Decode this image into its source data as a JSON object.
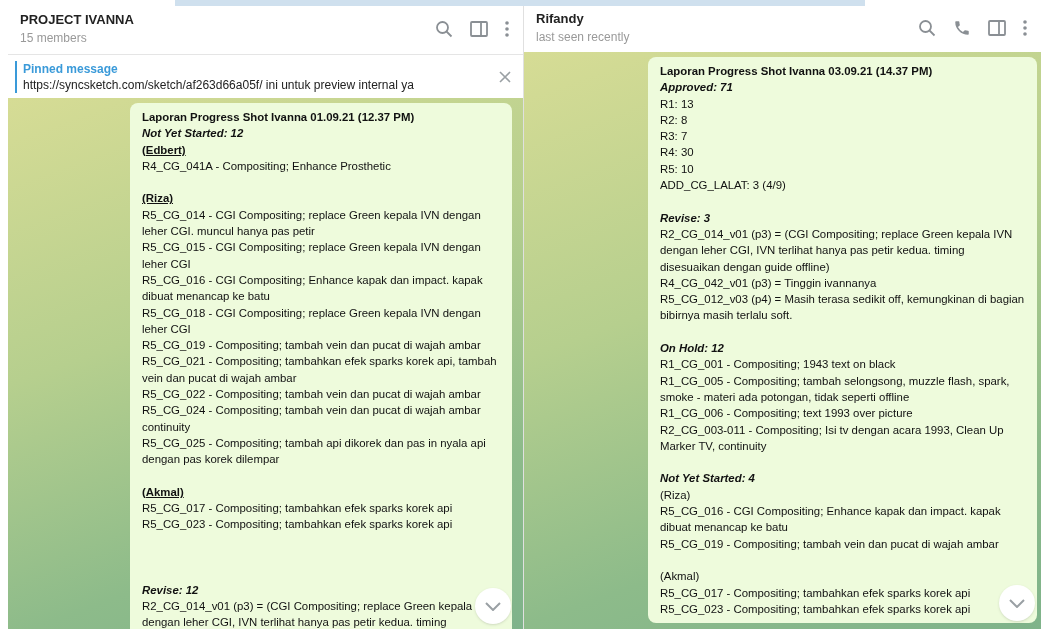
{
  "chats": [
    {
      "kind": "group",
      "title": "PROJECT IVANNA",
      "subtitle": "15 members",
      "pinned": {
        "label": "Pinned message",
        "text": "https://syncsketch.com/sketch/af263d66a05f/  ini untuk preview internal ya"
      },
      "message": [
        {
          "kind": "heading",
          "text": "Laporan Progress Shot Ivanna 01.09.21 (12.37 PM)"
        },
        {
          "kind": "status",
          "text": "Not Yet Started: 12"
        },
        {
          "kind": "person",
          "text": "(Edbert)"
        },
        {
          "kind": "item",
          "text": "R4_CG_041A - Compositing; Enhance Prosthetic"
        },
        {
          "kind": "blank"
        },
        {
          "kind": "person",
          "text": "(Riza)"
        },
        {
          "kind": "item",
          "text": "R5_CG_014 - CGI Compositing; replace Green kepala IVN dengan leher CGI. muncul hanya pas petir"
        },
        {
          "kind": "item",
          "text": "R5_CG_015 - CGI Compositing; replace Green kepala IVN dengan leher CGI"
        },
        {
          "kind": "item",
          "text": "R5_CG_016 - CGI Compositing; Enhance kapak dan impact. kapak dibuat menancap ke batu"
        },
        {
          "kind": "item",
          "text": "R5_CG_018 - CGI Compositing; replace Green kepala IVN dengan leher CGI"
        },
        {
          "kind": "item",
          "text": "R5_CG_019 - Compositing; tambah vein dan pucat di wajah ambar"
        },
        {
          "kind": "item",
          "text": "R5_CG_021 - Compositing; tambahkan efek sparks korek api, tambah vein dan pucat di wajah ambar"
        },
        {
          "kind": "item",
          "text": "R5_CG_022 - Compositing; tambah vein dan pucat di wajah ambar"
        },
        {
          "kind": "item",
          "text": "R5_CG_024 - Compositing; tambah vein dan pucat di wajah ambar continuity"
        },
        {
          "kind": "item",
          "text": "R5_CG_025 - Compositing; tambah api dikorek dan pas in nyala api dengan pas korek dilempar"
        },
        {
          "kind": "blank"
        },
        {
          "kind": "person",
          "text": "(Akmal)"
        },
        {
          "kind": "item",
          "text": "R5_CG_017 - Compositing; tambahkan efek sparks korek api"
        },
        {
          "kind": "item",
          "text": "R5_CG_023 - Compositing; tambahkan efek sparks korek api"
        },
        {
          "kind": "blank"
        },
        {
          "kind": "blank"
        },
        {
          "kind": "blank"
        },
        {
          "kind": "status",
          "text": "Revise: 12"
        },
        {
          "kind": "item",
          "text": "R2_CG_014_v01 (p3) = (CGI Compositing; replace Green kepala"
        },
        {
          "kind": "item",
          "text": "dengan leher CGI, IVN terlihat hanya pas petir kedua. timing"
        }
      ]
    },
    {
      "kind": "private",
      "title": "Rifandy",
      "subtitle": "last seen recently",
      "message": [
        {
          "kind": "heading",
          "text": "Laporan Progress Shot Ivanna 03.09.21 (14.37 PM)"
        },
        {
          "kind": "status",
          "text": "Approved: 71"
        },
        {
          "kind": "item",
          "text": "R1: 13"
        },
        {
          "kind": "item",
          "text": "R2: 8"
        },
        {
          "kind": "item",
          "text": "R3: 7"
        },
        {
          "kind": "item",
          "text": "R4: 30"
        },
        {
          "kind": "item",
          "text": "R5: 10"
        },
        {
          "kind": "item",
          "text": "ADD_CG_LALAT: 3 (4/9)"
        },
        {
          "kind": "blank"
        },
        {
          "kind": "status",
          "text": "Revise: 3"
        },
        {
          "kind": "item",
          "text": "R2_CG_014_v01 (p3) = (CGI Compositing; replace Green kepala IVN dengan leher CGI, IVN terlihat hanya pas petir kedua. timing disesuaikan dengan guide offline)"
        },
        {
          "kind": "item",
          "text": "R4_CG_042_v01 (p3) = Tinggin ivannanya"
        },
        {
          "kind": "item",
          "text": "R5_CG_012_v03 (p4) = Masih terasa sedikit off, kemungkinan di bagian bibirnya masih terlalu soft."
        },
        {
          "kind": "blank"
        },
        {
          "kind": "status",
          "text": "On Hold: 12"
        },
        {
          "kind": "item",
          "text": "R1_CG_001 - Compositing; 1943 text on black"
        },
        {
          "kind": "item",
          "text": "R1_CG_005 - Compositing; tambah selongsong, muzzle flash, spark, smoke - materi ada potongan, tidak seperti offline"
        },
        {
          "kind": "item",
          "text": "R1_CG_006 - Compositing; text 1993 over picture"
        },
        {
          "kind": "item",
          "text": "R2_CG_003-011 - Compositing; Isi tv dengan acara 1993, Clean Up Marker TV, continuity"
        },
        {
          "kind": "blank"
        },
        {
          "kind": "status",
          "text": "Not Yet Started: 4"
        },
        {
          "kind": "item",
          "text": "(Riza)"
        },
        {
          "kind": "item",
          "text": "R5_CG_016 - CGI Compositing; Enhance kapak dan impact. kapak dibuat menancap ke batu"
        },
        {
          "kind": "item",
          "text": "R5_CG_019 - Compositing; tambah vein dan pucat di wajah ambar"
        },
        {
          "kind": "blank"
        },
        {
          "kind": "item",
          "text": "(Akmal)"
        },
        {
          "kind": "item",
          "text": "R5_CG_017 - Compositing; tambahkan efek sparks korek api"
        },
        {
          "kind": "item",
          "text": "R5_CG_023 - Compositing; tambahkan efek sparks korek api"
        }
      ]
    }
  ]
}
